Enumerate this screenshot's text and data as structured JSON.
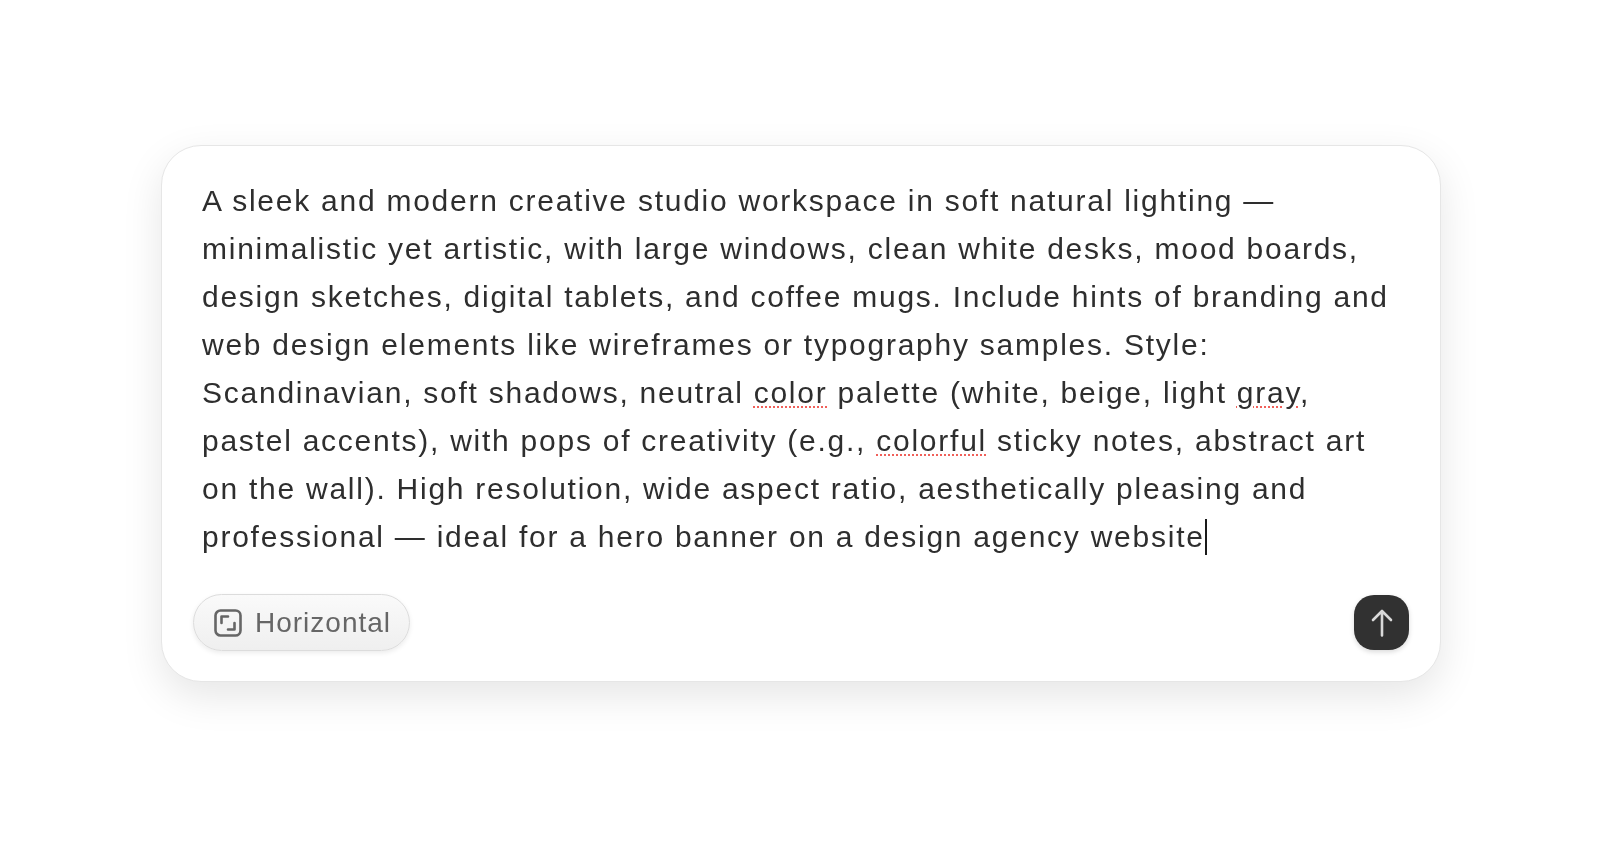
{
  "prompt": {
    "focused": true,
    "segments": [
      {
        "text": "A sleek and modern creative studio workspace in soft natural lighting — minimalistic yet artistic, with large windows, clean white desks, mood boards, design sketches, digital tablets, and coffee mugs. Include hints of branding and web design elements like wireframes or typography samples. Style: Scandinavian, soft shadows, neutral ",
        "misspelled": false
      },
      {
        "text": "color",
        "misspelled": true
      },
      {
        "text": " palette (white, beige, light ",
        "misspelled": false
      },
      {
        "text": "gray",
        "misspelled": true
      },
      {
        "text": ", pastel accents), with pops of creativity (e.g., ",
        "misspelled": false
      },
      {
        "text": "colorful",
        "misspelled": true
      },
      {
        "text": " sticky notes, abstract art on the wall). High resolution, wide aspect ratio, aesthetically pleasing and professional — ideal for a hero banner on a design agency website",
        "misspelled": false
      }
    ]
  },
  "aspect_button": {
    "label": "Horizontal"
  }
}
